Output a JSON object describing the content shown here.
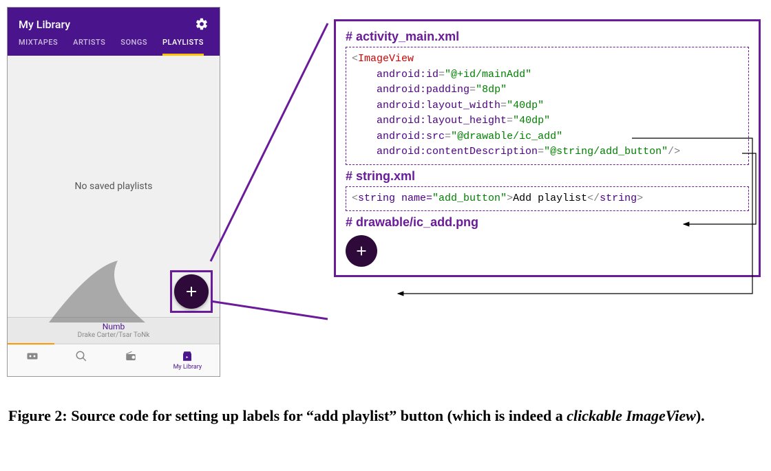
{
  "phone": {
    "header_title": "My Library",
    "tabs": [
      "MIXTAPES",
      "ARTISTS",
      "SONGS",
      "PLAYLISTS"
    ],
    "active_tab_index": 3,
    "empty_state": "No saved playlists",
    "now_playing": {
      "title": "Numb",
      "artist": "Drake Carter/Tsar ToNk"
    },
    "bottom_nav": {
      "library_label": "My Library"
    }
  },
  "code": {
    "section1_title": "# activity_main.xml",
    "xml": {
      "open_bracket": "<",
      "tag": "ImageView",
      "attr1_name": "android:id",
      "attr1_val": "\"@+id/mainAdd\"",
      "attr2_name": "android:padding",
      "attr2_val": "\"8dp\"",
      "attr3_name": "android:layout_width",
      "attr3_val": "\"40dp\"",
      "attr4_name": "android:layout_height",
      "attr4_val": "\"40dp\"",
      "attr5_name": "android:src",
      "attr5_val": "\"@drawable/ic_add\"",
      "attr6_name": "android:contentDescription",
      "attr6_val": "\"@string/add_button\"",
      "close": "/>"
    },
    "section2_title": "# string.xml",
    "string_line": {
      "open": "<",
      "tag": "string",
      "attr_name": " name=",
      "attr_val": "\"add_button\"",
      "close_open": ">",
      "text": "Add playlist",
      "close_tag": "</",
      "close_name": "string",
      "final": ">"
    },
    "section3_title": "# drawable/ic_add.png"
  },
  "caption": {
    "prefix": "Figure 2: Source code for setting up labels for “add playlist” button (which is indeed a ",
    "ital": "clickable ImageView",
    "suffix": ")."
  }
}
